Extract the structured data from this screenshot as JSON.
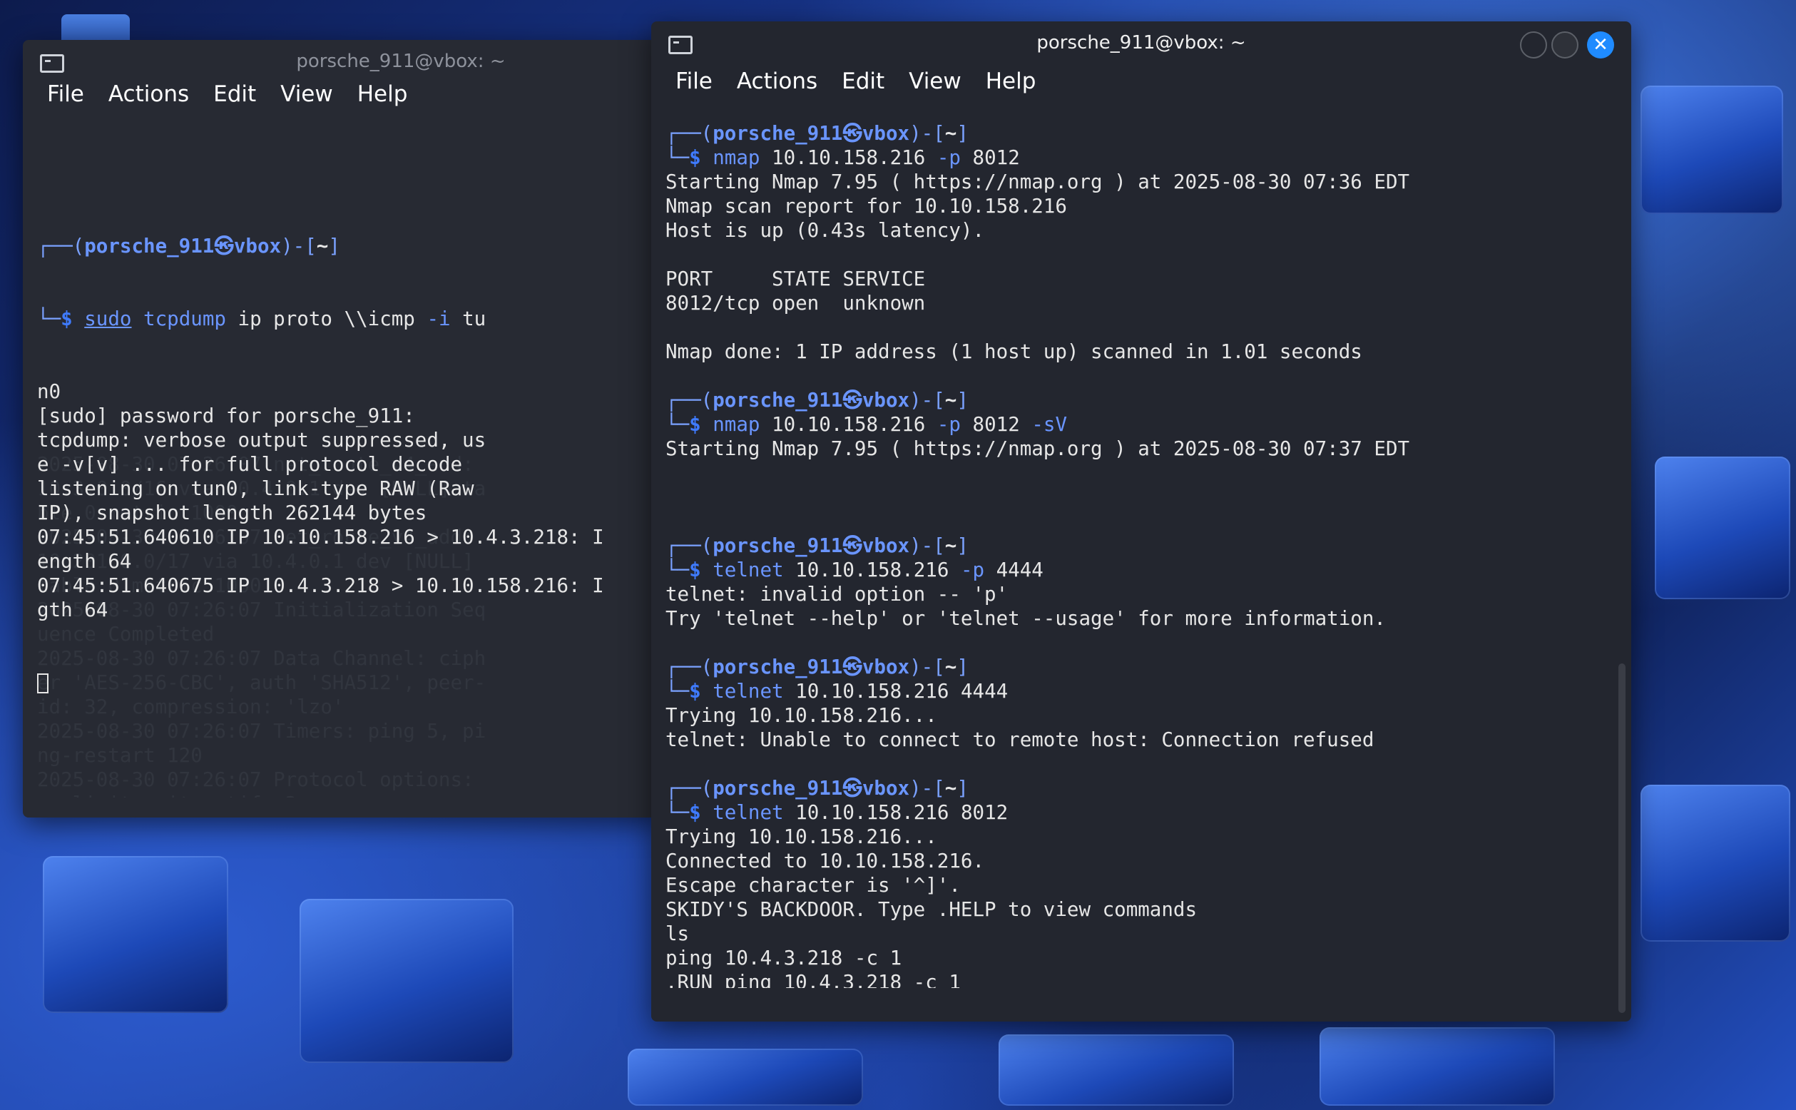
{
  "desktop": {
    "folder_icon": "folder-icon"
  },
  "left_window": {
    "title": "porsche_911@vbox: ~",
    "menu": [
      "File",
      "Actions",
      "Edit",
      "View",
      "Help"
    ],
    "prompt": {
      "user": "porsche_911",
      "at": "㉿",
      "host": "vbox",
      "dir": "~"
    },
    "command": {
      "sudo": "sudo",
      "cmd": "tcpdump",
      "args1": "ip proto \\\\icmp",
      "flag": "-i",
      "args2": "tu"
    },
    "output": [
      "n0",
      "[sudo] password for porsche_911:",
      "tcpdump: verbose output suppressed, us",
      "e -v[v] ... for full protocol decode",
      "listening on tun0, link-type RAW (Raw",
      "IP), snapshot length 262144 bytes",
      "07:45:51.640610 IP 10.10.158.216 > 10.4.3.218: I",
      "ength 64",
      "07:45:51.640675 IP 10.4.3.218 > 10.10.158.216: I",
      "gth 64"
    ],
    "ghost_lines": [
      "",
      "",
      "",
      "",
      "",
      "",
      "",
      "",
      "",
      "",
      "",
      "",
      "",
      "",
      "2025-08-30 07:26:07 net_route_v4_add:",
      "10.3.0.0/16 via 10.4.0.1 dev [NULL] ta",
      "ble 0 metric 1000",
      "2025-08-30 07:26:07 net_route_v4_add:",
      "10.201.0.0/17 via 10.4.0.1 dev [NULL]",
      "table 0 metric 1000",
      "2025-08-30 07:26:07 Initialization Seq",
      "uence Completed",
      "2025-08-30 07:26:07 Data Channel: ciph",
      "er 'AES-256-CBC', auth 'SHA512', peer-",
      "id: 32, compression: 'lzo'",
      "2025-08-30 07:26:07 Timers: ping 5, pi",
      "ng-restart 120",
      "2025-08-30 07:26:07 Protocol options:",
      "explicit-exit-notify 3"
    ]
  },
  "right_window": {
    "title": "porsche_911@vbox: ~",
    "menu": [
      "File",
      "Actions",
      "Edit",
      "View",
      "Help"
    ],
    "buttons": {
      "minimize": "minimize-button",
      "maximize": "maximize-button",
      "close": "✕"
    },
    "prompt": {
      "user": "porsche_911",
      "at": "㉿",
      "host": "vbox",
      "dir": "~"
    },
    "blocks": [
      {
        "cmd": "nmap",
        "a1": "10.10.158.216",
        "flag": "-p",
        "a2": "8012",
        "flag2": "",
        "output": [
          "Starting Nmap 7.95 ( https://nmap.org ) at 2025-08-30 07:36 EDT",
          "Nmap scan report for 10.10.158.216",
          "Host is up (0.43s latency).",
          "",
          "PORT     STATE SERVICE",
          "8012/tcp open  unknown",
          "",
          "Nmap done: 1 IP address (1 host up) scanned in 1.01 seconds"
        ]
      },
      {
        "cmd": "nmap",
        "a1": "10.10.158.216",
        "flag": "-p",
        "a2": "8012",
        "flag2": "-sV",
        "output": [
          "Starting Nmap 7.95 ( https://nmap.org ) at 2025-08-30 07:37 EDT",
          "",
          ""
        ]
      },
      {
        "cmd": "telnet",
        "a1": "10.10.158.216",
        "flag": "-p",
        "a2": "4444",
        "flag2": "",
        "output": [
          "telnet: invalid option -- 'p'",
          "Try 'telnet --help' or 'telnet --usage' for more information."
        ]
      },
      {
        "cmd": "telnet",
        "a1": "10.10.158.216",
        "flag": "",
        "a2": "4444",
        "flag2": "",
        "output": [
          "Trying 10.10.158.216...",
          "telnet: Unable to connect to remote host: Connection refused"
        ]
      },
      {
        "cmd": "telnet",
        "a1": "10.10.158.216",
        "flag": "",
        "a2": "8012",
        "flag2": "",
        "output": [
          "Trying 10.10.158.216...",
          "Connected to 10.10.158.216.",
          "Escape character is '^]'.",
          "SKIDY'S BACKDOOR. Type .HELP to view commands",
          "ls",
          "ping 10.4.3.218 -c 1",
          ".RUN ping 10.4.3.218 -c 1"
        ]
      }
    ]
  },
  "colors": {
    "accent": "#6a95ff",
    "close_button": "#1f8bff",
    "terminal_bg": "#23262f"
  }
}
